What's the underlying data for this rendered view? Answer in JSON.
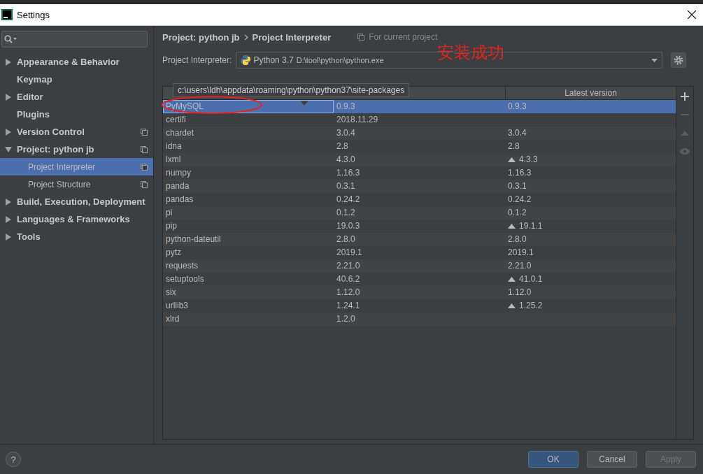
{
  "window": {
    "title": "Settings"
  },
  "sidebar": {
    "items": [
      {
        "label": "Appearance & Behavior",
        "kind": "group",
        "expanded": false,
        "project_scoped": false,
        "selected": false
      },
      {
        "label": "Keymap",
        "kind": "page",
        "project_scoped": false,
        "selected": false
      },
      {
        "label": "Editor",
        "kind": "group",
        "expanded": false,
        "project_scoped": false,
        "selected": false
      },
      {
        "label": "Plugins",
        "kind": "page",
        "project_scoped": false,
        "selected": false
      },
      {
        "label": "Version Control",
        "kind": "group",
        "expanded": false,
        "project_scoped": true,
        "selected": false
      },
      {
        "label": "Project: python jb",
        "kind": "group",
        "expanded": true,
        "project_scoped": true,
        "selected": false,
        "children": [
          {
            "label": "Project Interpreter",
            "project_scoped": true,
            "selected": true
          },
          {
            "label": "Project Structure",
            "project_scoped": true,
            "selected": false
          }
        ]
      },
      {
        "label": "Build, Execution, Deployment",
        "kind": "group",
        "expanded": false,
        "project_scoped": false,
        "selected": false
      },
      {
        "label": "Languages & Frameworks",
        "kind": "group",
        "expanded": false,
        "project_scoped": false,
        "selected": false
      },
      {
        "label": "Tools",
        "kind": "group",
        "expanded": false,
        "project_scoped": false,
        "selected": false
      }
    ]
  },
  "breadcrumb": [
    "Project: python jb",
    "Project Interpreter"
  ],
  "scope_note": "For current project",
  "interpreter": {
    "label": "Project Interpreter:",
    "name": "Python 3.7",
    "path": "D:\\tool\\python\\python.exe"
  },
  "annotation": "安装成功",
  "tooltip": "c:\\users\\ldh\\appdata\\roaming\\python\\python37\\site-packages",
  "table": {
    "column_3": "Latest version",
    "rows": [
      {
        "package": "PyMySQL",
        "version": "0.9.3",
        "latest": "0.9.3",
        "upgrade": false,
        "selected": true,
        "circled": true
      },
      {
        "package": "certifi",
        "version": "2018.11.29",
        "selected": false,
        "circled": false
      },
      {
        "package": "chardet",
        "version": "3.0.4",
        "latest": "3.0.4",
        "upgrade": false,
        "selected": false,
        "circled": false
      },
      {
        "package": "idna",
        "version": "2.8",
        "latest": "2.8",
        "upgrade": false,
        "selected": false,
        "circled": false
      },
      {
        "package": "lxml",
        "version": "4.3.0",
        "latest": "4.3.3",
        "upgrade": true,
        "selected": false,
        "circled": false
      },
      {
        "package": "numpy",
        "version": "1.16.3",
        "latest": "1.16.3",
        "upgrade": false,
        "selected": false,
        "circled": false
      },
      {
        "package": "panda",
        "version": "0.3.1",
        "latest": "0.3.1",
        "upgrade": false,
        "selected": false,
        "circled": false
      },
      {
        "package": "pandas",
        "version": "0.24.2",
        "latest": "0.24.2",
        "upgrade": false,
        "selected": false,
        "circled": false
      },
      {
        "package": "pi",
        "version": "0.1.2",
        "latest": "0.1.2",
        "upgrade": false,
        "selected": false,
        "circled": false
      },
      {
        "package": "pip",
        "version": "19.0.3",
        "latest": "19.1.1",
        "upgrade": true,
        "selected": false,
        "circled": false
      },
      {
        "package": "python-dateutil",
        "version": "2.8.0",
        "latest": "2.8.0",
        "upgrade": false,
        "selected": false,
        "circled": false
      },
      {
        "package": "pytz",
        "version": "2019.1",
        "latest": "2019.1",
        "upgrade": false,
        "selected": false,
        "circled": false
      },
      {
        "package": "requests",
        "version": "2.21.0",
        "latest": "2.21.0",
        "upgrade": false,
        "selected": false,
        "circled": false
      },
      {
        "package": "setuptools",
        "version": "40.6.2",
        "latest": "41.0.1",
        "upgrade": true,
        "selected": false,
        "circled": false
      },
      {
        "package": "six",
        "version": "1.12.0",
        "latest": "1.12.0",
        "upgrade": false,
        "selected": false,
        "circled": false
      },
      {
        "package": "urllib3",
        "version": "1.24.1",
        "latest": "1.25.2",
        "upgrade": true,
        "selected": false,
        "circled": false
      },
      {
        "package": "xlrd",
        "version": "1.2.0",
        "selected": false,
        "circled": false
      }
    ]
  },
  "side_tools": [
    {
      "kind": "add",
      "disabled": false
    },
    {
      "kind": "remove",
      "disabled": true
    },
    {
      "kind": "upgrade",
      "disabled": true
    },
    {
      "kind": "show",
      "disabled": true
    }
  ],
  "help": "?",
  "buttons": [
    {
      "label": "OK",
      "primary": true,
      "disabled": false
    },
    {
      "label": "Cancel",
      "primary": false,
      "disabled": false
    },
    {
      "label": "Apply",
      "primary": false,
      "disabled": true
    }
  ]
}
